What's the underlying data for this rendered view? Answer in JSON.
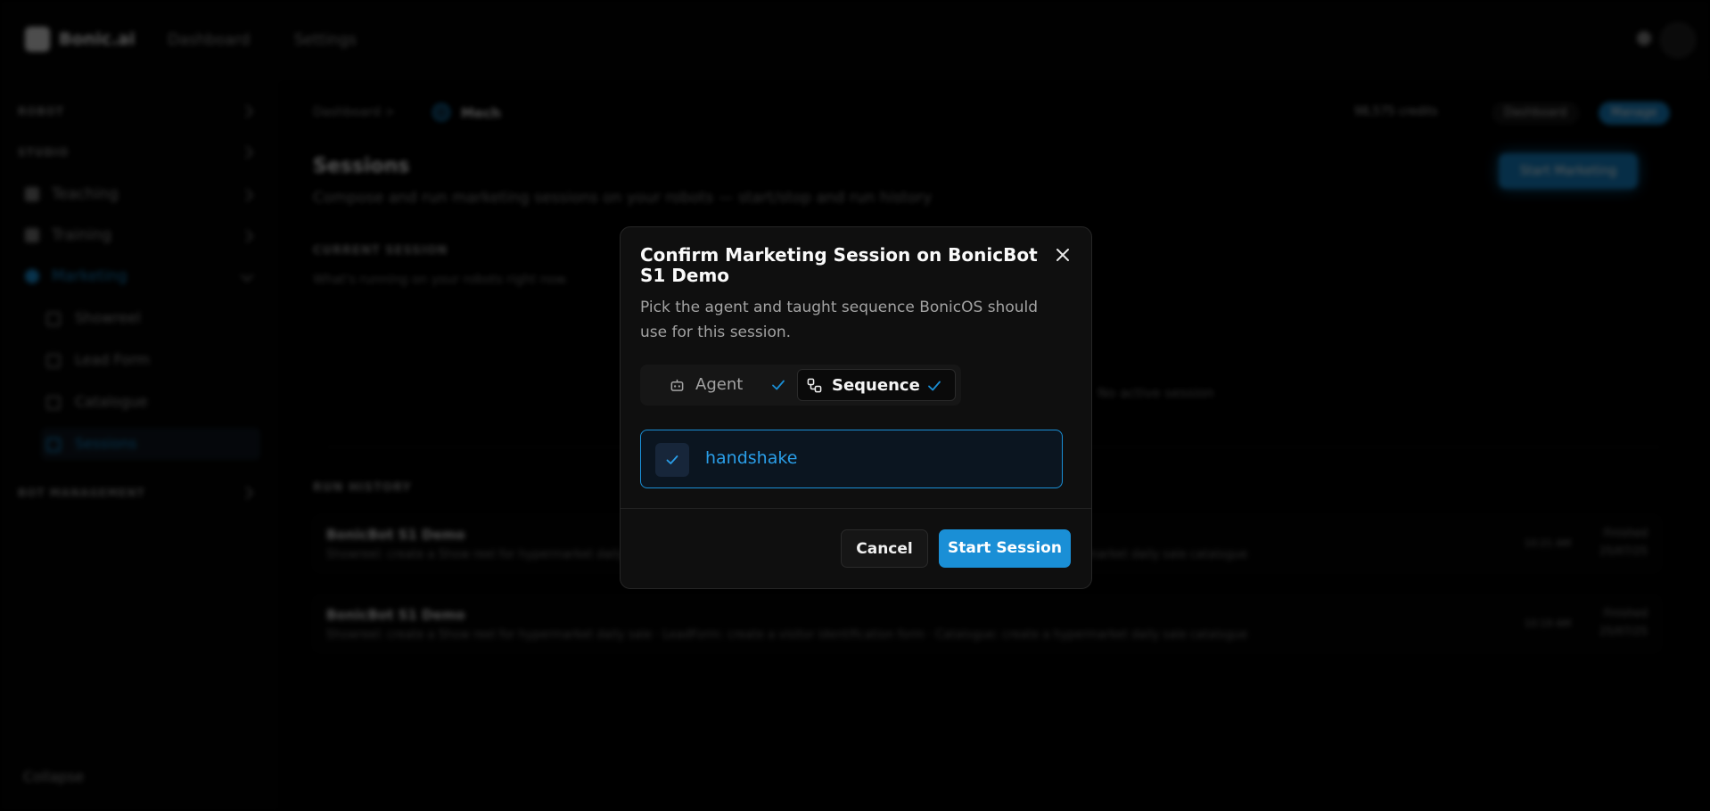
{
  "topbar": {
    "brand": "Bonic.ai",
    "nav": [
      "Dashboard",
      "Settings"
    ]
  },
  "sidebar": {
    "groups": [
      "ROBOT",
      "STUDIO",
      "BOT MANAGEMENT"
    ],
    "items": [
      "Teaching",
      "Training",
      "Marketing"
    ],
    "subitems": [
      "Showreel",
      "Lead Form",
      "Catalogue",
      "Sessions"
    ],
    "collapse": "Collapse"
  },
  "main": {
    "breadcrumb": "Dashboard  >",
    "robot": "Mech",
    "credits": "98,575 credits",
    "pill_dark": "Dashboard",
    "pill_blue": "Manage",
    "new_button": "Start Marketing",
    "title": "Sessions",
    "subtitle": "Compose and run marketing sessions on your robots — start/stop and run history",
    "current_section": "CURRENT SESSION",
    "current_note": "What's running on your robots right now.",
    "empty_note": "No active session",
    "history_section": "RUN HISTORY",
    "runs": [
      {
        "title": "BonicBot S1 Demo",
        "desc": "Showreel: create a Show reel for hypermarket daily sale · LeadForm: create a visitor identification form · Catalogue: create a hypermarket daily sale catalogue",
        "r1": "Finished",
        "r2": "25/07/25",
        "r3": "10:21 AM"
      },
      {
        "title": "BonicBot S1 Demo",
        "desc": "Showreel: create a Show reel for hypermarket daily sale · LeadForm: create a visitor identification form · Catalogue: create a hypermarket daily sale catalogue",
        "r1": "Finished",
        "r2": "25/07/25",
        "r3": "10:19 AM"
      }
    ]
  },
  "modal": {
    "title": "Confirm Marketing Session on BonicBot S1 Demo",
    "description": "Pick the agent and taught sequence BonicOS should use for this session.",
    "tabs": {
      "agent": "Agent",
      "sequence": "Sequence"
    },
    "option": "handshake",
    "cancel": "Cancel",
    "start": "Start Session"
  },
  "colors": {
    "accent": "#1a8fd6",
    "background": "#000000",
    "modal_bg": "#0f0f0f"
  }
}
